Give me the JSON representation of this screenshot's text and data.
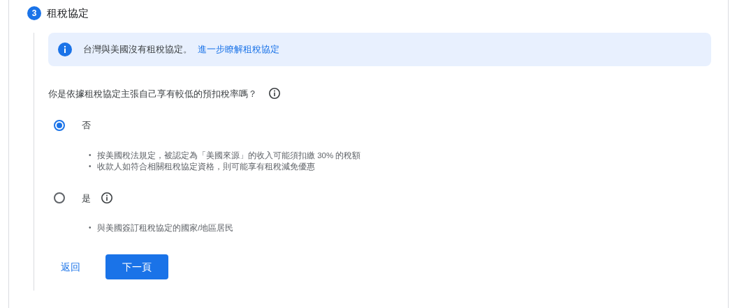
{
  "step": {
    "number": "3",
    "title": "租稅協定"
  },
  "notice": {
    "text": "台灣與美國沒有租稅協定。",
    "link": "進一步瞭解租稅協定"
  },
  "question": {
    "text": "你是依據租稅協定主張自己享有較低的預扣稅率嗎？",
    "info": true
  },
  "options": [
    {
      "label": "否",
      "selected": true,
      "info": false,
      "bullets": [
        {
          "marker": "•",
          "text": "按美國稅法規定，被認定為「美國來源」的收入可能須扣繳 30% 的稅額"
        },
        {
          "marker": "•",
          "text": "收款人如符合相關租稅協定資格，則可能享有租稅減免優惠"
        }
      ]
    },
    {
      "label": "是",
      "selected": false,
      "info": true,
      "bullets": [
        {
          "marker": "•",
          "text": "與美國簽訂租稅協定的國家/地區居民"
        }
      ]
    }
  ],
  "buttons": [
    {
      "label": "返回",
      "kind": "link"
    },
    {
      "label": "下一頁",
      "kind": "primary"
    }
  ]
}
